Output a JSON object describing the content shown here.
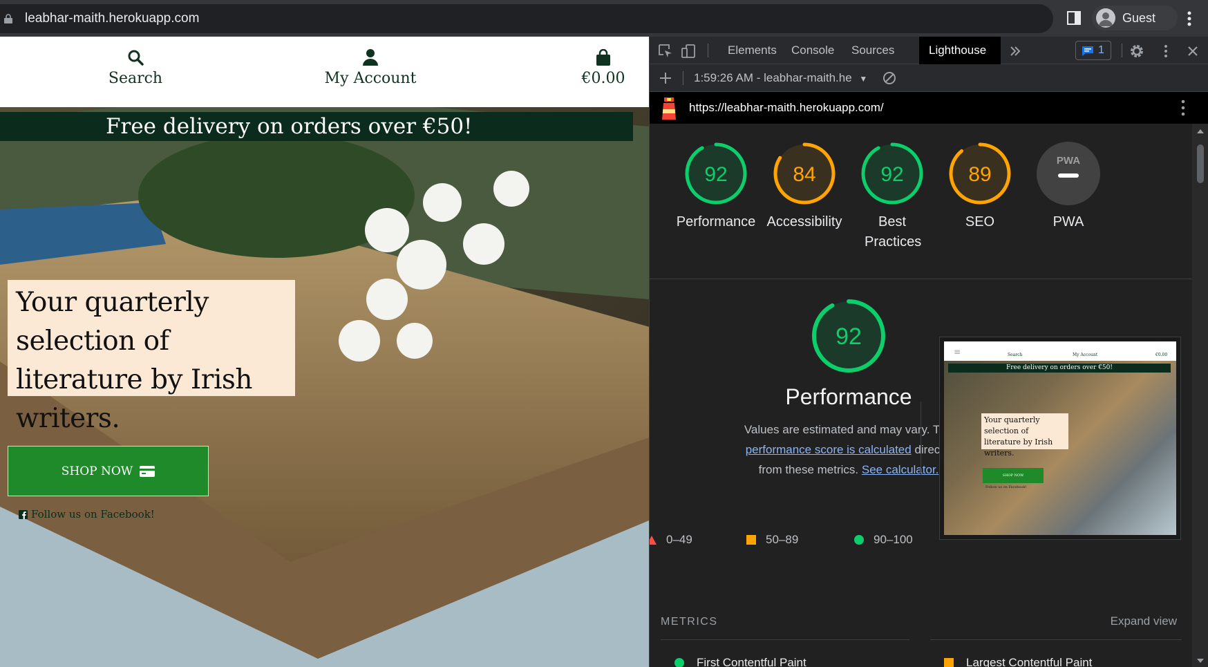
{
  "browser": {
    "url": "leabhar-maith.herokuapp.com",
    "profile_label": "Guest"
  },
  "site": {
    "nav": {
      "search_label": "Search",
      "account_label": "My Account",
      "cart_label": "€0.00"
    },
    "promo_text": "Free delivery on orders over €50!",
    "hero_text": "Your quarterly selection of literature by Irish writers.",
    "shop_button_label": "SHOP NOW",
    "facebook_label": "Follow us on Facebook!"
  },
  "devtools": {
    "tabs": [
      "Elements",
      "Console",
      "Sources",
      "Lighthouse"
    ],
    "active_tab": "Lighthouse",
    "issues_count": "1",
    "report_select": "1:59:26 AM - leabhar-maith.he",
    "lighthouse_url": "https://leabhar-maith.herokuapp.com/"
  },
  "lighthouse": {
    "scores": [
      {
        "label": "Performance",
        "value": 92,
        "status": "pass"
      },
      {
        "label": "Accessibility",
        "value": 84,
        "status": "average"
      },
      {
        "label": "Best Practices",
        "value": 92,
        "status": "pass"
      },
      {
        "label": "SEO",
        "value": 89,
        "status": "average"
      },
      {
        "label": "PWA",
        "value": null,
        "status": "na"
      }
    ],
    "pwa_badge": "PWA",
    "performance": {
      "score": 92,
      "title": "Performance",
      "desc_prefix": "Values are estimated and may vary. The ",
      "desc_link1": "performance score is calculated",
      "desc_middle": " directly from these metrics. ",
      "desc_link2": "See calculator."
    },
    "legend": [
      "0–49",
      "50–89",
      "90–100"
    ],
    "metrics_title": "METRICS",
    "expand_view": "Expand view",
    "metrics": [
      {
        "label": "First Contentful Paint",
        "status": "pass"
      },
      {
        "label": "Largest Contentful Paint",
        "status": "average"
      }
    ],
    "thumbnail": {
      "search": "Search",
      "account": "My Account",
      "cart": "€0.00",
      "banner": "Free delivery on orders over €50!",
      "hero": "Your quarterly selection of literature by Irish writers.",
      "button": "SHOP NOW",
      "facebook": "Follow us on Facebook!"
    }
  },
  "colors": {
    "pass": "#0cce6b",
    "average": "#ffa400",
    "fail": "#ff4e42",
    "brand_green": "#0b2b1c",
    "button_green": "#1f8a2a"
  }
}
